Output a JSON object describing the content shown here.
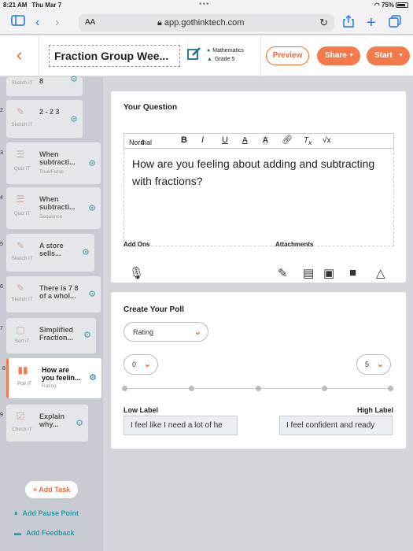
{
  "status_bar": {
    "time": "8:21 AM",
    "date": "Thu Mar 7",
    "battery": "75%"
  },
  "browser": {
    "aa": "AA",
    "url": "app.gothinktech.com"
  },
  "header": {
    "title": "Fraction Group Wee...",
    "subject": "Mathematics",
    "grade": "Grade 5",
    "preview_label": "Preview",
    "share_label": "Share",
    "start_label": "Start"
  },
  "sidebar": {
    "tasks": [
      {
        "num": "",
        "type": "Sketch iT",
        "title": "8",
        "subtitle": ""
      },
      {
        "num": "2",
        "type": "Sketch iT",
        "title": "2 - 2 3",
        "subtitle": ""
      },
      {
        "num": "3",
        "type": "Quiz iT",
        "title": "When subtracti...",
        "subtitle": "True/False"
      },
      {
        "num": "4",
        "type": "Quiz iT",
        "title": "When subtracti...",
        "subtitle": "Sequence"
      },
      {
        "num": "5",
        "type": "Sketch iT",
        "title": "A store sells...",
        "subtitle": ""
      },
      {
        "num": "6",
        "type": "Sketch iT",
        "title": "There is 7 8 of a whol...",
        "subtitle": ""
      },
      {
        "num": "7",
        "type": "Sort iT",
        "title": "Simplified Fraction...",
        "subtitle": ""
      },
      {
        "num": "8",
        "type": "Poll iT",
        "title": "How are you feelin...",
        "subtitle": "Rating"
      },
      {
        "num": "9",
        "type": "Check iT",
        "title": "Explain why...",
        "subtitle": ""
      }
    ],
    "add_task": "+ Add Task",
    "add_pause": "Add Pause Point",
    "add_feedback": "Add Feedback"
  },
  "question": {
    "heading": "Your Question",
    "format": "Normal",
    "text": "How are you feeling about adding and subtracting with fractions?",
    "add_ons": "Add Ons",
    "attachments": "Attachments"
  },
  "poll": {
    "heading": "Create Your Poll",
    "type": "Rating",
    "min": "0",
    "max": "5",
    "low_label": "Low Label",
    "high_label": "High Label",
    "low_value": "I feel like I need a lot of he",
    "high_value": "I feel confident and ready"
  },
  "colors": {
    "accent": "#f47a4d",
    "teal": "#2b9aa6",
    "sidebar_bg": "#c8cbd1"
  }
}
